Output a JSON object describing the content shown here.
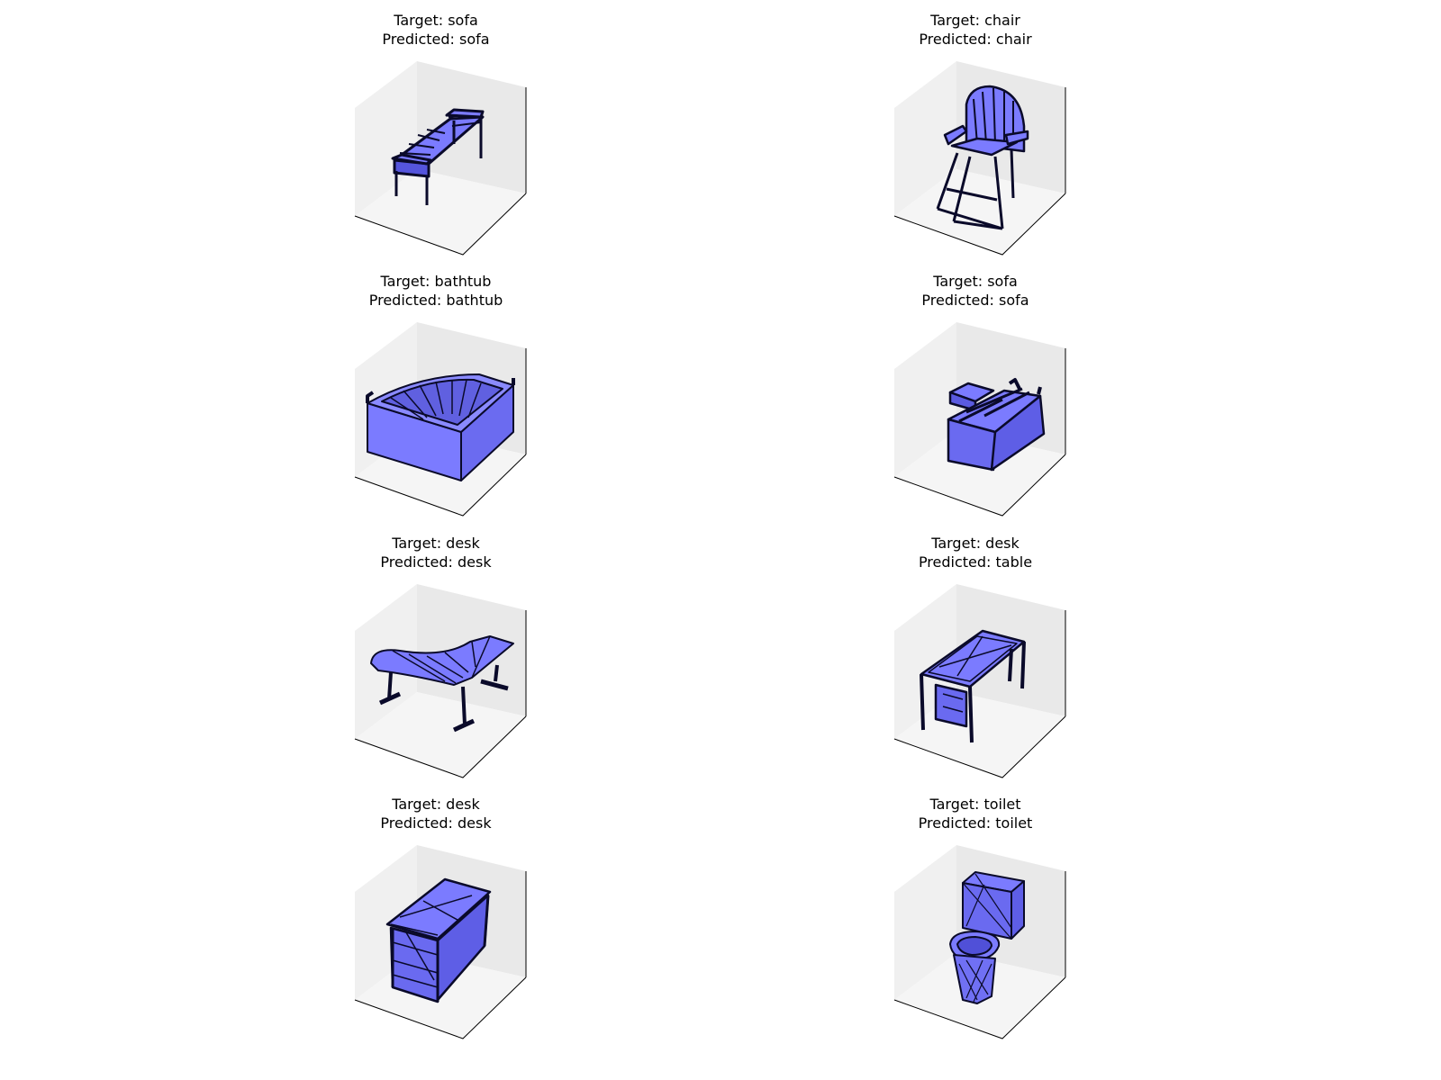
{
  "panels": [
    {
      "target": "Target: sofa",
      "predicted": "Predicted: sofa",
      "object": "sofa-long-bench"
    },
    {
      "target": "Target: chair",
      "predicted": "Predicted: chair",
      "object": "chair"
    },
    {
      "target": "Target: bathtub",
      "predicted": "Predicted: bathtub",
      "object": "bathtub"
    },
    {
      "target": "Target: sofa",
      "predicted": "Predicted: sofa",
      "object": "sofa-sectional"
    },
    {
      "target": "Target: desk",
      "predicted": "Predicted: desk",
      "object": "desk-curved"
    },
    {
      "target": "Target: desk",
      "predicted": "Predicted: table",
      "object": "desk-frame"
    },
    {
      "target": "Target: desk",
      "predicted": "Predicted: desk",
      "object": "desk-drawers"
    },
    {
      "target": "Target: toilet",
      "predicted": "Predicted: toilet",
      "object": "toilet"
    }
  ],
  "colors": {
    "mesh_fill": "#7b7bff",
    "mesh_edge": "#0a0a2a",
    "pane_back": "#f0f0f0",
    "pane_side": "#e6e6e6",
    "pane_floor": "#f5f5f5"
  }
}
